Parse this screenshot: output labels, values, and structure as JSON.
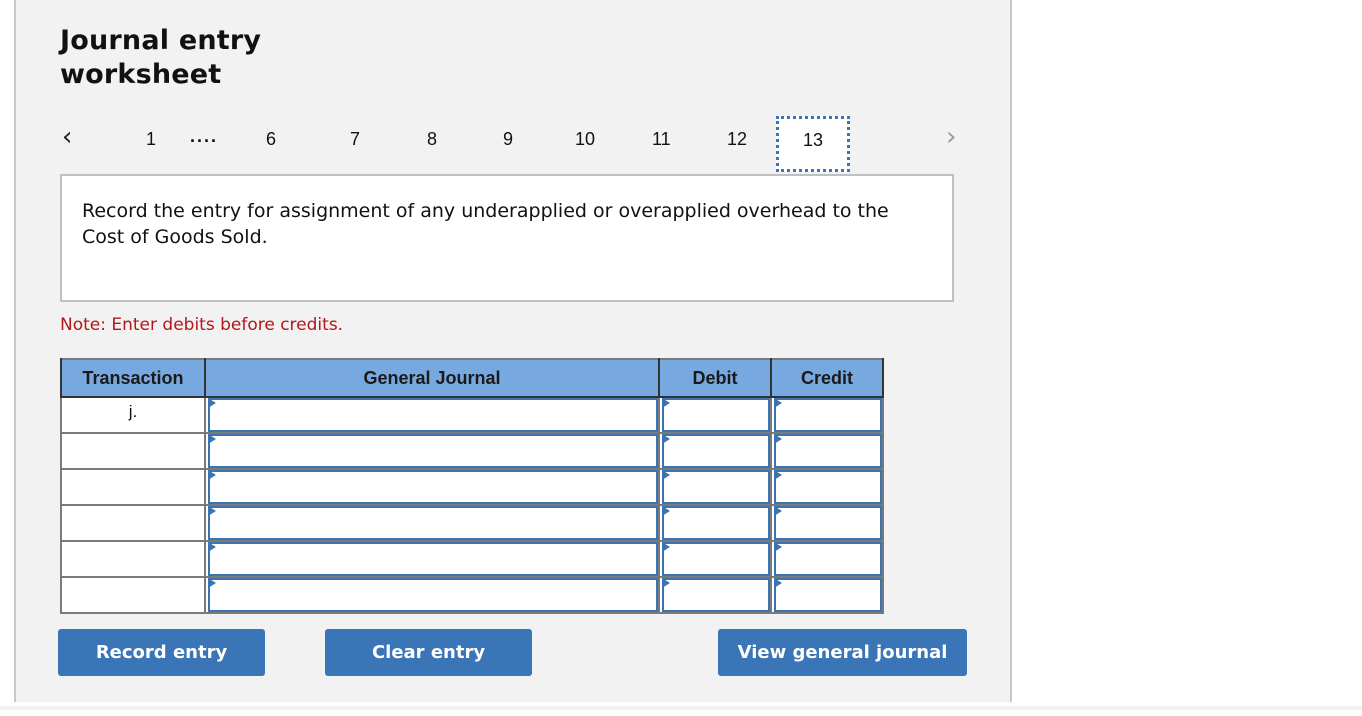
{
  "title_line1": "Journal entry",
  "title_line2": "worksheet",
  "pagination": {
    "prev_icon": "chevron-left-icon",
    "next_icon": "chevron-right-icon",
    "first": "1",
    "ellipsis": "....",
    "pages": [
      "6",
      "7",
      "8",
      "9",
      "10",
      "11",
      "12"
    ],
    "active": "13"
  },
  "prompt": "Record the entry for assignment of any underapplied or overapplied overhead to the Cost of Goods Sold.",
  "note": "Note: Enter debits before credits.",
  "table": {
    "headers": [
      "Transaction",
      "General Journal",
      "Debit",
      "Credit"
    ],
    "rows": [
      {
        "transaction": "j.",
        "account": "",
        "debit": "",
        "credit": ""
      },
      {
        "transaction": "",
        "account": "",
        "debit": "",
        "credit": ""
      },
      {
        "transaction": "",
        "account": "",
        "debit": "",
        "credit": ""
      },
      {
        "transaction": "",
        "account": "",
        "debit": "",
        "credit": ""
      },
      {
        "transaction": "",
        "account": "",
        "debit": "",
        "credit": ""
      },
      {
        "transaction": "",
        "account": "",
        "debit": "",
        "credit": ""
      }
    ]
  },
  "buttons": {
    "record": "Record entry",
    "clear": "Clear entry",
    "view": "View general journal"
  },
  "colors": {
    "accent": "#3a76b7",
    "header_bg": "#77a9e0",
    "note": "#b3161b"
  }
}
